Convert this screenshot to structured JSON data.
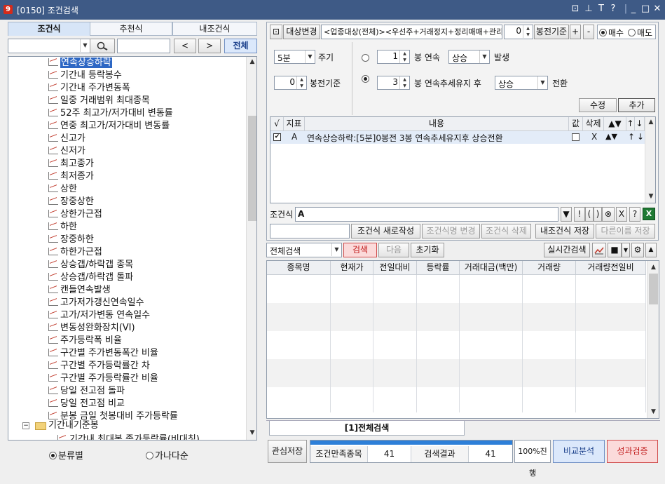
{
  "window": {
    "title": "[0150] 조건검색",
    "logo": "9"
  },
  "tabs": [
    "조건식",
    "추천식",
    "내조건식"
  ],
  "search": {
    "value": "",
    "filter_value": "",
    "prev": "<",
    "next": ">",
    "all": "전체"
  },
  "tree": {
    "items": [
      "연속상승하락",
      "기간내 등락봉수",
      "기간내 주가변동폭",
      "일중 거래범위 최대종목",
      "52주 최고가/저가대비 변동률",
      "연중 최고가/저가대비 변동률",
      "신고가",
      "신저가",
      "최고종가",
      "최저종가",
      "상한",
      "장중상한",
      "상한가근접",
      "하한",
      "장중하한",
      "하한가근접",
      "상승갭/하락갭 종목",
      "상승갭/하락갭 돌파",
      "캔들연속발생",
      "고가저가갱신연속일수",
      "고가/저가변동 연속일수",
      "변동성완화장치(VI)",
      "주가등락폭 비율",
      "구간별 주가변동폭간 비율",
      "구간별 주가등락률간 차",
      "구간별 주가등락률간 비율",
      "당일 전고점 돌파",
      "당일 전고점 비교",
      "분봉 금일 첫봉대비 주가등락률"
    ],
    "folder": "기간내기준봉",
    "partial": "기간내 최대봉 종가등락률(비대칭)"
  },
  "bottom_left": {
    "opt1": "분류별",
    "opt2": "가나다순"
  },
  "toolbar": {
    "target_change": "대상변경",
    "target_text": "<업종대상(전체)><우선주+거래정지+정리매매+관리",
    "bong_value": "0",
    "bong_label": "봉전기준",
    "plus": "+",
    "minus": "-",
    "buy": "매수",
    "sell": "매도"
  },
  "settings": {
    "period": "5분",
    "period_label": "주기",
    "bong_value": "0",
    "bong_label": "봉전기준",
    "row1": {
      "n": "1",
      "a": "봉 연속",
      "dir": "상승",
      "b": "발생"
    },
    "row2": {
      "n": "3",
      "a": "봉 연속추세유지 후",
      "dir": "상승",
      "b": "전환"
    },
    "modify": "수정",
    "add": "추가"
  },
  "cond_grid": {
    "headers": [
      "√",
      "지표",
      "내용",
      "값",
      "삭제",
      "▲▼",
      "↑",
      "↓"
    ],
    "row": {
      "id": "A",
      "content": "연속상승하락:[5분]0봉전 3봉 연속추세유지후 상승전환",
      "del": "X",
      "updown": "▲▼",
      "up": "↑",
      "down": "↓"
    }
  },
  "formula": {
    "label": "조건식",
    "value": "A",
    "buttons": [
      "▼",
      "!",
      "(",
      ")",
      "⊗",
      "X",
      "?"
    ]
  },
  "actions": {
    "new_write": "조건식 새로작성",
    "rename": "조건식명 변경",
    "delete": "조건식 삭제",
    "my_save": "내조건식 저장",
    "save_as": "다른이름 저장"
  },
  "search_bar": {
    "mode": "전체검색",
    "search": "검색",
    "next": "다음",
    "reset": "초기화",
    "realtime": "실시간검색"
  },
  "result_grid": {
    "headers": [
      "종목명",
      "현재가",
      "전일대비",
      "등락률",
      "거래대금(백만)",
      "거래량",
      "거래량전일비"
    ]
  },
  "result_tab": "[1]전체검색",
  "status": {
    "interest_save": "관심저장",
    "match_label": "조건만족종목",
    "match_count": "41",
    "result_label": "검색결과",
    "result_count": "41",
    "progress": "100%진행",
    "progress_value": 1.0,
    "compare": "비교분석",
    "verify": "성과검증"
  },
  "colors": {
    "title_bg": "#3e5a86",
    "selection": "#2d67c4",
    "accent_red": "#d62a1a",
    "progress": "#2d7fd8"
  }
}
